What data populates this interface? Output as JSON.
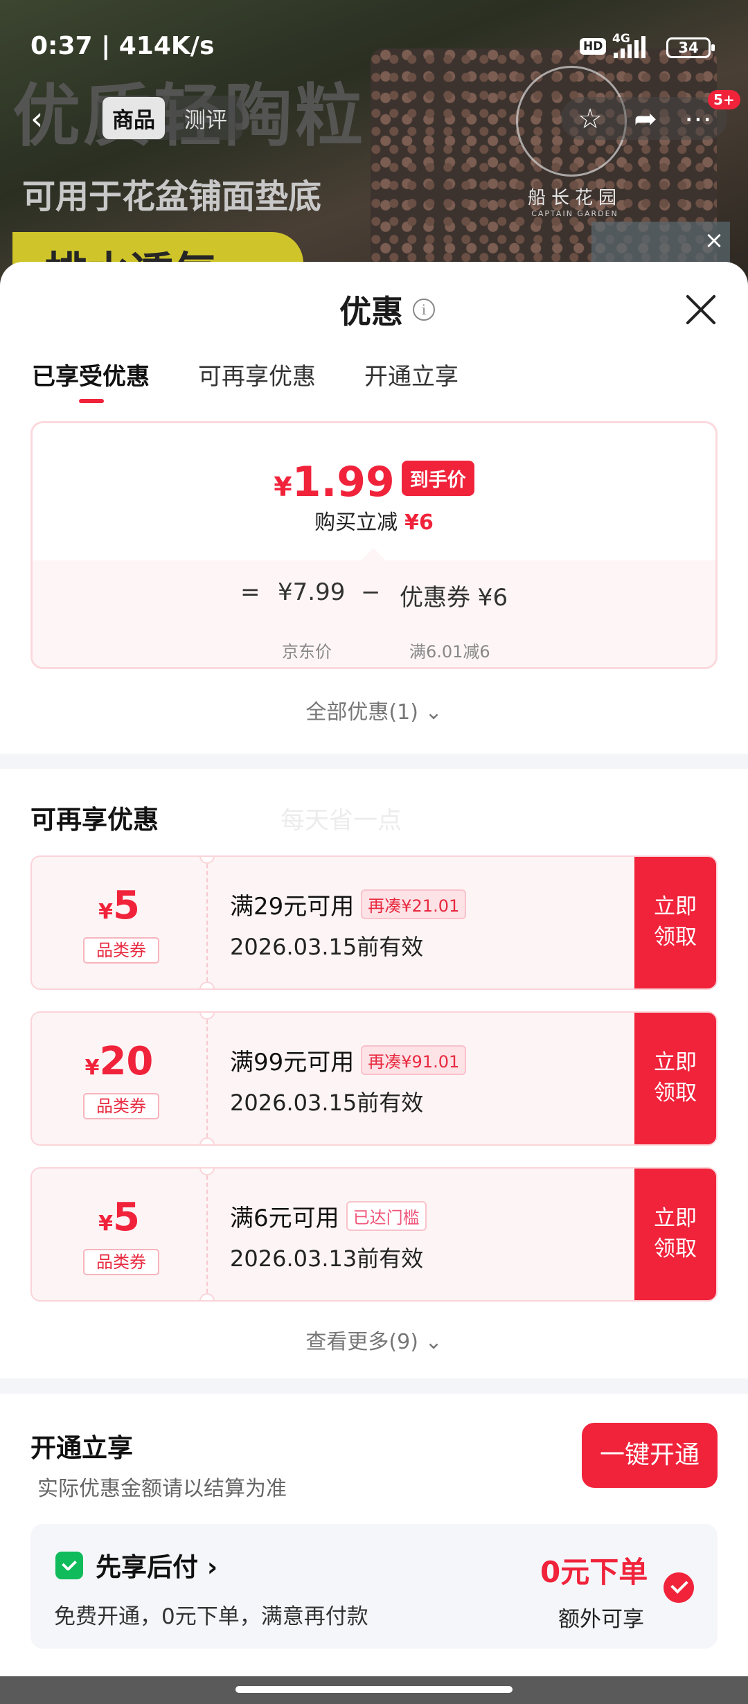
{
  "status_bar": {
    "time_speed": "0:37 | 414K/s",
    "hd": "HD",
    "network": "4G",
    "battery": "34"
  },
  "product_bg": {
    "headline": "优质轻陶粒",
    "subline": "可用于花盆铺面垫底",
    "banner": "排水透气",
    "logo_text": "船长花园",
    "logo_sub": "CAPTAIN GARDEN"
  },
  "nav": {
    "tabs": [
      {
        "label": "商品"
      },
      {
        "label": "测评"
      }
    ],
    "icons": [
      "back-icon",
      "star-icon",
      "share-icon",
      "more-icon"
    ],
    "badge": "5+"
  },
  "sheet": {
    "title": "优惠",
    "tabs": [
      {
        "label": "已享受优惠"
      },
      {
        "label": "可再享优惠"
      },
      {
        "label": "开通立享"
      }
    ],
    "price_card": {
      "currency": "¥",
      "final_price": "1.99",
      "final_tag": "到手价",
      "discount_text": "购买立减",
      "discount_value": "¥6",
      "eq": "=",
      "jd_price": "¥7.99",
      "minus": "−",
      "coupon_text": "优惠券 ¥6",
      "jd_label": "京东价",
      "coupon_label": "满6.01减6"
    },
    "all_discounts": "全部优惠(1)",
    "more_section": {
      "title": "可再享优惠",
      "watermark": "每天省一点",
      "coupons": [
        {
          "currency": "¥",
          "value": "5",
          "type": "品类券",
          "condition": "满29元可用",
          "badge": "再凑¥21.01",
          "validity": "2026.03.15前有效",
          "button_l1": "立即",
          "button_l2": "领取"
        },
        {
          "currency": "¥",
          "value": "20",
          "type": "品类券",
          "condition": "满99元可用",
          "badge": "再凑¥91.01",
          "validity": "2026.03.15前有效",
          "button_l1": "立即",
          "button_l2": "领取"
        },
        {
          "currency": "¥",
          "value": "5",
          "type": "品类券",
          "condition": "满6元可用",
          "badge": "已达门槛",
          "validity": "2026.03.13前有效",
          "button_l1": "立即",
          "button_l2": "领取"
        }
      ],
      "view_more": "查看更多(9)"
    },
    "open_section": {
      "title": "开通立享",
      "subtitle": "实际优惠金额请以结算为准",
      "button": "一键开通",
      "bnpl": {
        "title": "先享后付",
        "desc": "免费开通，0元下单，满意再付款",
        "zero_order": "0元下单",
        "extra": "额外可享"
      }
    }
  },
  "colors": {
    "accent": "#f0233b",
    "coupon_bg": "#fdf4f5",
    "bnpl_green": "#0fbb5b"
  }
}
